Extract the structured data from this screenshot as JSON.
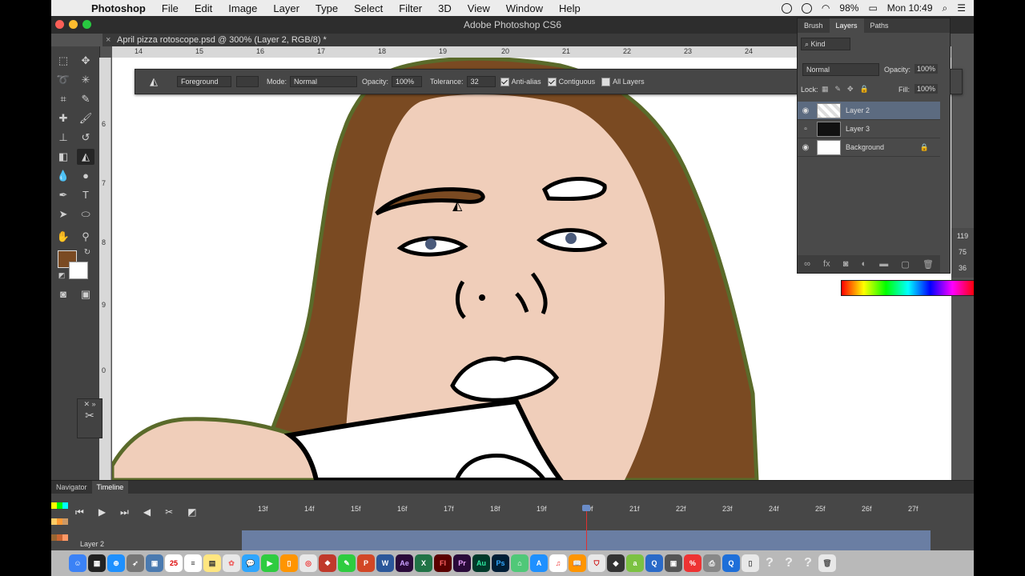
{
  "menubar": {
    "items": [
      "Photoshop",
      "File",
      "Edit",
      "Image",
      "Layer",
      "Type",
      "Select",
      "Filter",
      "3D",
      "View",
      "Window",
      "Help"
    ],
    "battery": "98%",
    "clock": "Mon 10:49"
  },
  "window": {
    "title": "Adobe Photoshop CS6"
  },
  "document": {
    "tab_label": "April pizza rotoscope.psd @ 300% (Layer 2, RGB/8) *"
  },
  "rulers": {
    "horizontal": [
      "14",
      "15",
      "16",
      "17",
      "18",
      "19",
      "20",
      "21",
      "22",
      "23",
      "24"
    ],
    "vertical": [
      "6",
      "7",
      "8",
      "9",
      "0"
    ]
  },
  "options_bar": {
    "fill_source": "Foreground",
    "mode_label": "Mode:",
    "mode_value": "Normal",
    "opacity_label": "Opacity:",
    "opacity_value": "100%",
    "tolerance_label": "Tolerance:",
    "tolerance_value": "32",
    "anti_alias": "Anti-alias",
    "contiguous": "Contiguous",
    "all_layers": "All Layers"
  },
  "layers_panel": {
    "tabs": [
      "Brush",
      "Layers",
      "Paths"
    ],
    "kind_filter": "Kind",
    "blend_mode": "Normal",
    "opacity_label": "Opacity:",
    "opacity_value": "100%",
    "lock_label": "Lock:",
    "fill_label": "Fill:",
    "fill_value": "100%",
    "layers": [
      {
        "name": "Layer 2",
        "visible": true,
        "selected": true
      },
      {
        "name": "Layer 3",
        "visible": false,
        "selected": false
      },
      {
        "name": "Background",
        "visible": true,
        "selected": false,
        "locked": true
      }
    ]
  },
  "side_values": [
    "119",
    "75",
    "36"
  ],
  "timeline": {
    "tabs": [
      "Navigator",
      "Timeline"
    ],
    "frames": [
      "13f",
      "14f",
      "15f",
      "16f",
      "17f",
      "18f",
      "19f",
      "20f",
      "21f",
      "22f",
      "23f",
      "24f",
      "25f",
      "26f",
      "27f"
    ],
    "layer_label": "Layer 2",
    "playhead_frame": "20f"
  },
  "colors": {
    "foreground": "#7a4a22",
    "background": "#ffffff",
    "hair": "#7a4a22",
    "skin": "#f0ceba",
    "outline": "#5a6a2a"
  },
  "dock_icons": [
    "finder",
    "launchpad",
    "safari",
    "rocket",
    "preview",
    "calendar",
    "notes",
    "reminders",
    "photos",
    "messages",
    "facetime",
    "ibooks",
    "chrome",
    "evernote",
    "powerpoint",
    "word",
    "aftereffects",
    "excel",
    "flash",
    "premiere",
    "audition",
    "photoshop",
    "maps",
    "appstore",
    "itunes",
    "ibooks2",
    "pdf",
    "sketchup",
    "acrobat",
    "quicktime",
    "percent",
    "printer",
    "files",
    "help1",
    "help2",
    "help3",
    "trash"
  ]
}
